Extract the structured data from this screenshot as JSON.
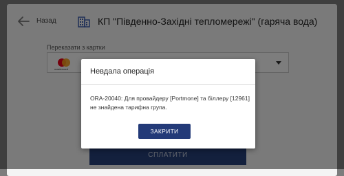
{
  "header": {
    "back_label": "Назад",
    "title": "КП \"Південно-Західні тепломережі\" (гаряча вода)",
    "title_icon": "building-icon"
  },
  "payment": {
    "card_label": "Переказати з картки",
    "card_brand_text": "mastercard",
    "pay_label": "СПЛАТИТИ"
  },
  "dialog": {
    "title": "Невдала операція",
    "message": "ORA-20040: Для провайдеру [Portmone] та біллеру [12961] не знайдена тарифна група.",
    "close_label": "ЗАКРИТИ"
  },
  "colors": {
    "primary": "#233a78",
    "overlay": "rgba(0,0,0,0.5)"
  }
}
